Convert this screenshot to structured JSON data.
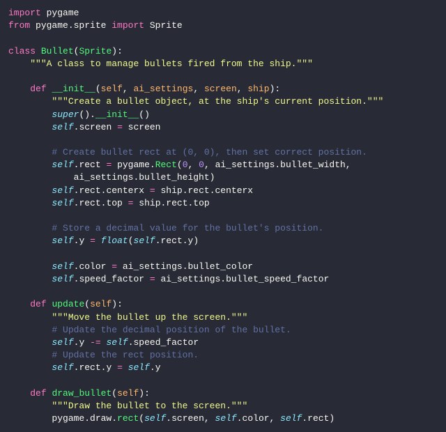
{
  "code": {
    "lines": [
      {
        "indent": 0,
        "tokens": [
          [
            "kw",
            "import"
          ],
          [
            "ident",
            " pygame"
          ]
        ]
      },
      {
        "indent": 0,
        "tokens": [
          [
            "kw",
            "from"
          ],
          [
            "ident",
            " pygame.sprite "
          ],
          [
            "kw",
            "import"
          ],
          [
            "ident",
            " Sprite"
          ]
        ]
      },
      {
        "indent": 0,
        "tokens": []
      },
      {
        "indent": 0,
        "tokens": [
          [
            "kw",
            "class"
          ],
          [
            "ident",
            " "
          ],
          [
            "cls",
            "Bullet"
          ],
          [
            "punc",
            "("
          ],
          [
            "cls",
            "Sprite"
          ],
          [
            "punc",
            ")"
          ],
          [
            "punc",
            ":"
          ]
        ]
      },
      {
        "indent": 1,
        "tokens": [
          [
            "str",
            "\"\"\"A class to manage bullets fired from the ship.\"\"\""
          ]
        ]
      },
      {
        "indent": 0,
        "tokens": []
      },
      {
        "indent": 1,
        "tokens": [
          [
            "kw",
            "def"
          ],
          [
            "ident",
            " "
          ],
          [
            "call",
            "__init__"
          ],
          [
            "punc",
            "("
          ],
          [
            "param",
            "self"
          ],
          [
            "punc",
            ", "
          ],
          [
            "param",
            "ai_settings"
          ],
          [
            "punc",
            ", "
          ],
          [
            "param",
            "screen"
          ],
          [
            "punc",
            ", "
          ],
          [
            "param",
            "ship"
          ],
          [
            "punc",
            "):"
          ]
        ]
      },
      {
        "indent": 2,
        "tokens": [
          [
            "str",
            "\"\"\"Create a bullet object, at the ship's current position.\"\"\""
          ]
        ]
      },
      {
        "indent": 2,
        "tokens": [
          [
            "builtin",
            "super"
          ],
          [
            "punc",
            "()."
          ],
          [
            "call",
            "__init__"
          ],
          [
            "punc",
            "()"
          ]
        ]
      },
      {
        "indent": 2,
        "tokens": [
          [
            "builtin",
            "self"
          ],
          [
            "punc",
            "."
          ],
          [
            "attr",
            "screen "
          ],
          [
            "op",
            "="
          ],
          [
            "ident",
            " screen"
          ]
        ]
      },
      {
        "indent": 0,
        "tokens": []
      },
      {
        "indent": 2,
        "tokens": [
          [
            "cmt",
            "# Create bullet rect at (0, 0), then set correct position."
          ]
        ]
      },
      {
        "indent": 2,
        "tokens": [
          [
            "builtin",
            "self"
          ],
          [
            "punc",
            "."
          ],
          [
            "attr",
            "rect "
          ],
          [
            "op",
            "="
          ],
          [
            "ident",
            " pygame."
          ],
          [
            "call",
            "Rect"
          ],
          [
            "punc",
            "("
          ],
          [
            "num",
            "0"
          ],
          [
            "punc",
            ", "
          ],
          [
            "num",
            "0"
          ],
          [
            "punc",
            ", ai_settings.bullet_width,"
          ]
        ]
      },
      {
        "indent": 3,
        "tokens": [
          [
            "punc",
            "ai_settings.bullet_height)"
          ]
        ]
      },
      {
        "indent": 2,
        "tokens": [
          [
            "builtin",
            "self"
          ],
          [
            "punc",
            "."
          ],
          [
            "attr",
            "rect.centerx "
          ],
          [
            "op",
            "="
          ],
          [
            "ident",
            " ship.rect.centerx"
          ]
        ]
      },
      {
        "indent": 2,
        "tokens": [
          [
            "builtin",
            "self"
          ],
          [
            "punc",
            "."
          ],
          [
            "attr",
            "rect.top "
          ],
          [
            "op",
            "="
          ],
          [
            "ident",
            " ship.rect.top"
          ]
        ]
      },
      {
        "indent": 0,
        "tokens": []
      },
      {
        "indent": 2,
        "tokens": [
          [
            "cmt",
            "# Store a decimal value for the bullet's position."
          ]
        ]
      },
      {
        "indent": 2,
        "tokens": [
          [
            "builtin",
            "self"
          ],
          [
            "punc",
            "."
          ],
          [
            "attr",
            "y "
          ],
          [
            "op",
            "="
          ],
          [
            "ident",
            " "
          ],
          [
            "builtin",
            "float"
          ],
          [
            "punc",
            "("
          ],
          [
            "builtin",
            "self"
          ],
          [
            "punc",
            ".rect.y)"
          ]
        ]
      },
      {
        "indent": 0,
        "tokens": []
      },
      {
        "indent": 2,
        "tokens": [
          [
            "builtin",
            "self"
          ],
          [
            "punc",
            "."
          ],
          [
            "attr",
            "color "
          ],
          [
            "op",
            "="
          ],
          [
            "ident",
            " ai_settings.bullet_color"
          ]
        ]
      },
      {
        "indent": 2,
        "tokens": [
          [
            "builtin",
            "self"
          ],
          [
            "punc",
            "."
          ],
          [
            "attr",
            "speed_factor "
          ],
          [
            "op",
            "="
          ],
          [
            "ident",
            " ai_settings.bullet_speed_factor"
          ]
        ]
      },
      {
        "indent": 0,
        "tokens": []
      },
      {
        "indent": 1,
        "tokens": [
          [
            "kw",
            "def"
          ],
          [
            "ident",
            " "
          ],
          [
            "call",
            "update"
          ],
          [
            "punc",
            "("
          ],
          [
            "param",
            "self"
          ],
          [
            "punc",
            "):"
          ]
        ]
      },
      {
        "indent": 2,
        "tokens": [
          [
            "str",
            "\"\"\"Move the bullet up the screen.\"\"\""
          ]
        ]
      },
      {
        "indent": 2,
        "tokens": [
          [
            "cmt",
            "# Update the decimal position of the bullet."
          ]
        ]
      },
      {
        "indent": 2,
        "tokens": [
          [
            "builtin",
            "self"
          ],
          [
            "punc",
            "."
          ],
          [
            "attr",
            "y "
          ],
          [
            "op",
            "-="
          ],
          [
            "ident",
            " "
          ],
          [
            "builtin",
            "self"
          ],
          [
            "punc",
            ".speed_factor"
          ]
        ]
      },
      {
        "indent": 2,
        "tokens": [
          [
            "cmt",
            "# Update the rect position."
          ]
        ]
      },
      {
        "indent": 2,
        "tokens": [
          [
            "builtin",
            "self"
          ],
          [
            "punc",
            "."
          ],
          [
            "attr",
            "rect.y "
          ],
          [
            "op",
            "="
          ],
          [
            "ident",
            " "
          ],
          [
            "builtin",
            "self"
          ],
          [
            "punc",
            ".y"
          ]
        ]
      },
      {
        "indent": 0,
        "tokens": []
      },
      {
        "indent": 1,
        "tokens": [
          [
            "kw",
            "def"
          ],
          [
            "ident",
            " "
          ],
          [
            "call",
            "draw_bullet"
          ],
          [
            "punc",
            "("
          ],
          [
            "param",
            "self"
          ],
          [
            "punc",
            "):"
          ]
        ]
      },
      {
        "indent": 2,
        "tokens": [
          [
            "str",
            "\"\"\"Draw the bullet to the screen.\"\"\""
          ]
        ]
      },
      {
        "indent": 2,
        "tokens": [
          [
            "ident",
            "pygame.draw."
          ],
          [
            "call",
            "rect"
          ],
          [
            "punc",
            "("
          ],
          [
            "builtin",
            "self"
          ],
          [
            "punc",
            ".screen, "
          ],
          [
            "builtin",
            "self"
          ],
          [
            "punc",
            ".color, "
          ],
          [
            "builtin",
            "self"
          ],
          [
            "punc",
            ".rect)"
          ]
        ]
      }
    ],
    "indent_unit": "    "
  }
}
